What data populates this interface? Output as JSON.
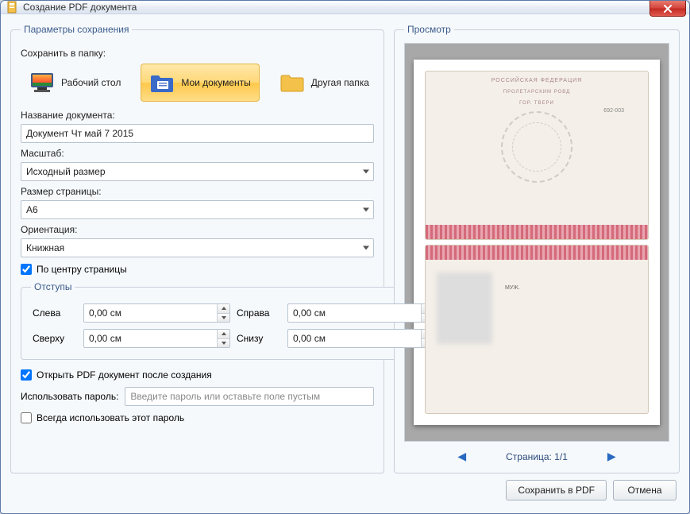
{
  "titlebar": {
    "title": "Создание PDF документа"
  },
  "params": {
    "legend": "Параметры сохранения",
    "save_folder_label": "Сохранить в папку:",
    "folders": {
      "desktop": "Рабочий стол",
      "documents": "Мои документы",
      "other": "Другая папка"
    },
    "doc_name_label": "Название документа:",
    "doc_name_value": "Документ Чт май 7 2015",
    "scale_label": "Масштаб:",
    "scale_value": "Исходный размер",
    "page_size_label": "Размер страницы:",
    "page_size_value": "А6",
    "orientation_label": "Ориентация:",
    "orientation_value": "Книжная",
    "center_label": "По центру страницы",
    "margins_legend": "Отступы",
    "margins": {
      "left_label": "Слева",
      "right_label": "Справа",
      "top_label": "Сверху",
      "bottom_label": "Снизу",
      "left": "0,00 см",
      "right": "0,00 см",
      "top": "0,00 см",
      "bottom": "0,00 см"
    },
    "open_after_label": "Открыть PDF документ после создания",
    "password_label": "Использовать пароль:",
    "password_placeholder": "Введите пароль или оставьте поле пустым",
    "always_password_label": "Всегда использовать этот пароль"
  },
  "preview": {
    "legend": "Просмотр",
    "doc_country": "РОССИЙСКАЯ ФЕДЕРАЦИЯ",
    "doc_line1": "ПРОЛЕТАРСКИМ РОВД",
    "doc_line2": "ГОР. ТВЕРИ",
    "doc_code": "692-003",
    "doc_gender": "МУЖ.",
    "page_label": "Страница: 1/1"
  },
  "footer": {
    "save": "Сохранить в PDF",
    "cancel": "Отмена"
  }
}
